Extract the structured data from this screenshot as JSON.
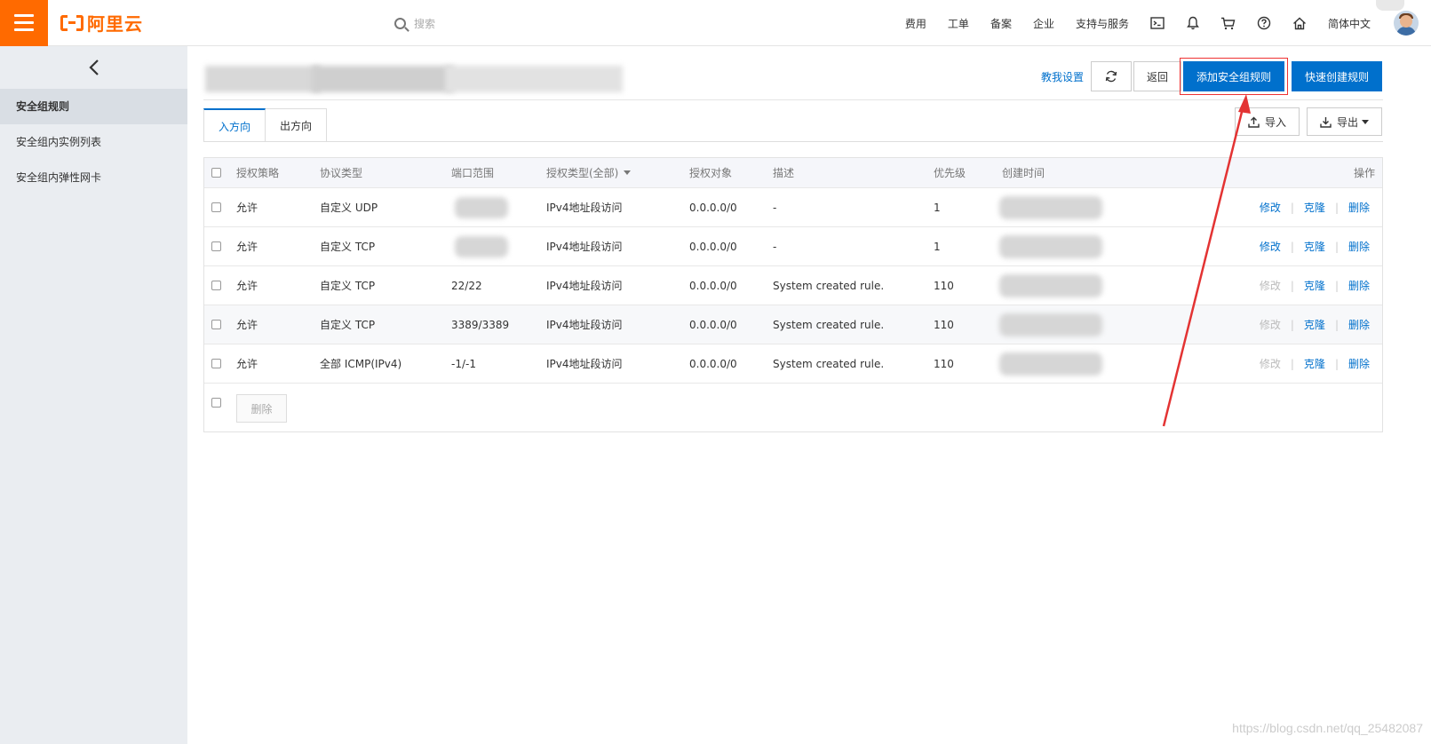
{
  "brand": {
    "name": "阿里云",
    "color": "#ff6a00"
  },
  "search": {
    "placeholder": "搜索"
  },
  "topnav": {
    "items": [
      "费用",
      "工单",
      "备案",
      "企业",
      "支持与服务"
    ],
    "icons": [
      "terminal-icon",
      "bell-icon",
      "cart-icon",
      "help-icon",
      "home-icon"
    ],
    "language": "简体中文"
  },
  "sidebar": {
    "items": [
      {
        "label": "安全组规则"
      },
      {
        "label": "安全组内实例列表"
      },
      {
        "label": "安全组内弹性网卡"
      }
    ]
  },
  "header": {
    "help_link": "教我设置",
    "back": "返回",
    "add_rule": "添加安全组规则",
    "quick_create": "快速创建规则"
  },
  "tabs": [
    "入方向",
    "出方向"
  ],
  "io": {
    "import": "导入",
    "export": "导出"
  },
  "table": {
    "columns": [
      "授权策略",
      "协议类型",
      "端口范围",
      "授权类型(全部)",
      "授权对象",
      "描述",
      "优先级",
      "创建时间",
      "操作"
    ],
    "rows": [
      {
        "policy": "允许",
        "protocol": "自定义 UDP",
        "port": "",
        "auth_type": "IPv4地址段访问",
        "target": "0.0.0.0/0",
        "desc": "-",
        "priority": "1",
        "edit_enabled": true
      },
      {
        "policy": "允许",
        "protocol": "自定义 TCP",
        "port": "",
        "auth_type": "IPv4地址段访问",
        "target": "0.0.0.0/0",
        "desc": "-",
        "priority": "1",
        "edit_enabled": true
      },
      {
        "policy": "允许",
        "protocol": "自定义 TCP",
        "port": "22/22",
        "auth_type": "IPv4地址段访问",
        "target": "0.0.0.0/0",
        "desc": "System created rule.",
        "priority": "110",
        "edit_enabled": false
      },
      {
        "policy": "允许",
        "protocol": "自定义 TCP",
        "port": "3389/3389",
        "auth_type": "IPv4地址段访问",
        "target": "0.0.0.0/0",
        "desc": "System created rule.",
        "priority": "110",
        "edit_enabled": false
      },
      {
        "policy": "允许",
        "protocol": "全部 ICMP(IPv4)",
        "port": "-1/-1",
        "auth_type": "IPv4地址段访问",
        "target": "0.0.0.0/0",
        "desc": "System created rule.",
        "priority": "110",
        "edit_enabled": false
      }
    ],
    "actions": {
      "edit": "修改",
      "clone": "克隆",
      "delete": "删除"
    },
    "footer_delete": "删除"
  },
  "watermark": "https://blog.csdn.net/qq_25482087",
  "colors": {
    "primary": "#0070cc",
    "annotation": "#e33333"
  }
}
